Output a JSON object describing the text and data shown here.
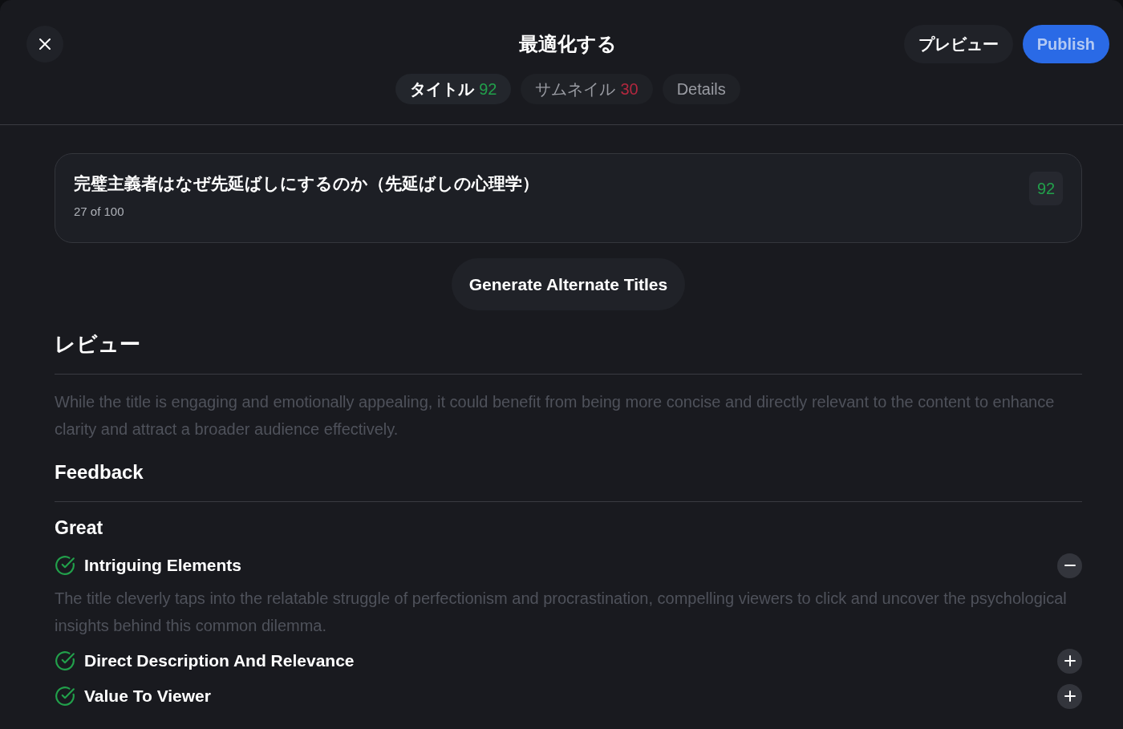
{
  "header": {
    "title": "最適化する",
    "actions": [
      {
        "label": "プレビュー",
        "kind": "secondary"
      },
      {
        "label": "Publish",
        "kind": "primary"
      }
    ]
  },
  "tabs": [
    {
      "label": "タイトル",
      "score": "92",
      "color": "#22a04b",
      "selected": true
    },
    {
      "label": "サムネイル",
      "score": "30",
      "color": "#b3283f",
      "selected": false
    },
    {
      "label": "Details",
      "selected": false
    }
  ],
  "title_card": {
    "title": "完璧主義者はなぜ先延ばしにするのか（先延ばしの心理学）",
    "counter": "27 of 100",
    "score": "92"
  },
  "generate_button": "Generate Alternate Titles",
  "review": {
    "heading": "レビュー",
    "text": "While the title is engaging and emotionally appealing, it could benefit from being more concise and directly relevant to the content to enhance clarity and attract a broader audience effectively."
  },
  "feedback": {
    "heading": "Feedback",
    "groups": [
      {
        "heading": "Great",
        "items": [
          {
            "label": "Intriguing Elements",
            "expanded": true,
            "description": "The title cleverly taps into the relatable struggle of perfectionism and procrastination, compelling viewers to click and uncover the psychological insights behind this common dilemma."
          },
          {
            "label": "Direct Description And Relevance",
            "expanded": false
          },
          {
            "label": "Value To Viewer",
            "expanded": false
          }
        ]
      }
    ]
  }
}
